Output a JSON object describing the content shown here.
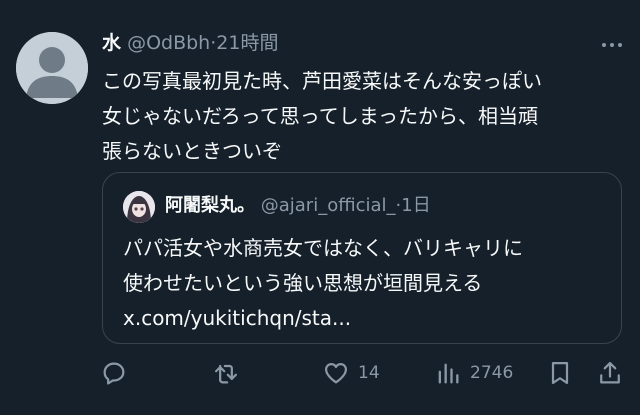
{
  "tweet": {
    "display_name": "水",
    "handle": "@OdBbh",
    "separator": "·",
    "time": "21時間",
    "body_lines": [
      "この写真最初見た時、芦田愛菜はそんな安っぽい",
      "女じゃないだろって思ってしまったから、相当頑",
      "張らないときついぞ"
    ]
  },
  "quote": {
    "display_name": "阿闍梨丸。",
    "handle": "@ajari_official_",
    "separator": "·",
    "time": "1日",
    "body_lines": [
      "パパ活女や水商売女ではなく、バリキャリに",
      "使わせたいという強い思想が垣間見える",
      "x.com/yukitichqn/sta..."
    ]
  },
  "actions": {
    "reply_icon": "reply-icon",
    "retweet_icon": "retweet-icon",
    "like_icon": "heart-icon",
    "like_count": "14",
    "views_icon": "views-icon",
    "views_count": "2746",
    "bookmark_icon": "bookmark-icon",
    "share_icon": "share-icon"
  },
  "colors": {
    "background": "#15202b",
    "text": "#f7f9f9",
    "muted": "#8b98a5",
    "border": "#38444d"
  }
}
